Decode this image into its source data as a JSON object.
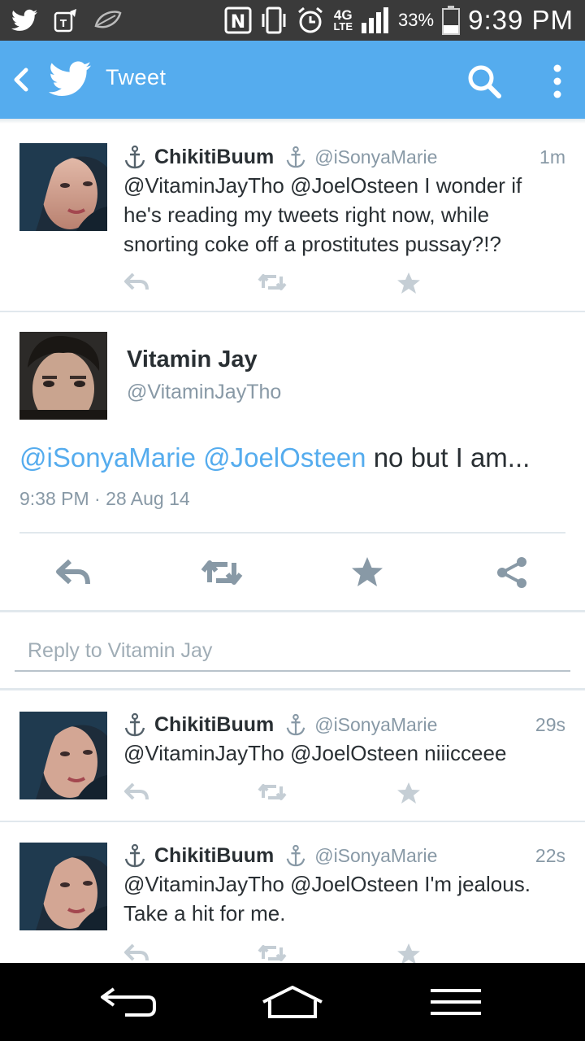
{
  "status_bar": {
    "time": "9:39 PM",
    "battery_percent": "33%",
    "network": "4G",
    "network_sub": "LTE",
    "icons": [
      "twitter-icon",
      "tmobile-icon",
      "leaf-icon",
      "nfc-icon",
      "vibrate-icon",
      "alarm-icon",
      "signal-icon",
      "battery-icon"
    ]
  },
  "app_bar": {
    "title": "Tweet",
    "icons": [
      "back-icon",
      "twitter-bird-icon",
      "search-icon",
      "overflow-menu-icon"
    ],
    "color": "#55acee"
  },
  "tweets_before": [
    {
      "name": "ChikitiBuum",
      "handle": "@iSonyaMarie",
      "time": "1m",
      "text": "@VitaminJayTho @JoelOsteen I wonder if he's reading my tweets right now, while snorting coke off a prostitutes pussay?!?"
    }
  ],
  "detail": {
    "name": "Vitamin Jay",
    "handle": "@VitaminJayTho",
    "mention1": "@iSonyaMarie",
    "mention2": "@JoelOsteen",
    "text_rest": "no but I am...",
    "date": "9:38 PM · 28 Aug 14",
    "actions": [
      "reply-icon",
      "retweet-icon",
      "favorite-icon",
      "share-icon"
    ]
  },
  "reply": {
    "placeholder": "Reply to Vitamin Jay"
  },
  "tweets_after": [
    {
      "name": "ChikitiBuum",
      "handle": "@iSonyaMarie",
      "time": "29s",
      "text": "@VitaminJayTho @JoelOsteen niiicceee"
    },
    {
      "name": "ChikitiBuum",
      "handle": "@iSonyaMarie",
      "time": "22s",
      "text": "@VitaminJayTho @JoelOsteen I'm jealous. Take a hit for me."
    }
  ],
  "nav_bar": {
    "icons": [
      "nav-back-icon",
      "nav-home-icon",
      "nav-menu-icon"
    ]
  }
}
